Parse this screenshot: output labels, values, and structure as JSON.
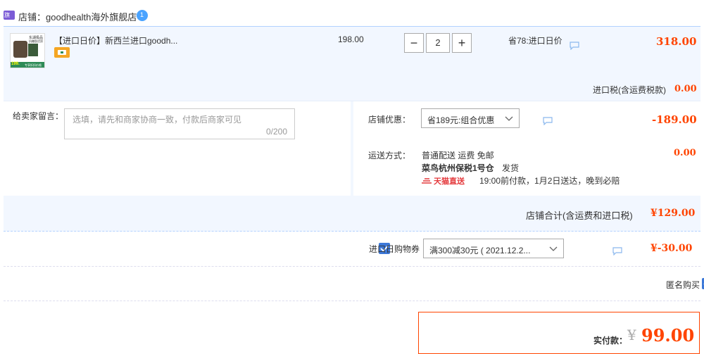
{
  "shop": {
    "label": "店铺：goodhealth海外旗舰店",
    "badge_text": "1",
    "shop_icon_text": "旗舰"
  },
  "item": {
    "title": "【进口日价】新西兰进口goodh...",
    "unit_price": "198.00",
    "quantity": "2",
    "discount_note": "省78:进口日价",
    "subtotal": "318.00",
    "thumb_caption_1": "东湖极品",
    "thumb_caption_2": "抗糖肽优质",
    "thumb_price": "199.",
    "thumb_footer": "专享折扣价格"
  },
  "tax": {
    "label": "进口税(含运费税款)",
    "value": "0.00"
  },
  "message": {
    "label": "给卖家留言：",
    "placeholder": "选填，请先和商家协商一致，付款后商家可见",
    "counter": "0/200"
  },
  "store_discount": {
    "label": "店铺优惠：",
    "selected": "省189元:组合优惠",
    "value": "-189.00"
  },
  "shipping": {
    "label": "运送方式：",
    "method": "普通配送 运费 免邮",
    "warehouse": "菜鸟杭州保税1号仓",
    "dispatch": "发货",
    "tmall_logo": "天猫直送",
    "promise": "19:00前付款，1月2日送达，晚到必赔",
    "value": "0.00"
  },
  "store_total": {
    "label": "店铺合计(含运费和进口税)",
    "value": "¥129.00"
  },
  "coupon": {
    "label": "进口日购物券",
    "selected": "满300减30元 ( 2021.12.2...",
    "value": "¥-30.00"
  },
  "anonymous": {
    "label": "匿名购买"
  },
  "payment": {
    "label": "实付款：",
    "currency": "¥",
    "amount": "99.00"
  },
  "colors": {
    "accent": "#f40",
    "panel": "#f2f7ff",
    "border": "#b2d1ff",
    "checkbox": "#3c78d8"
  }
}
